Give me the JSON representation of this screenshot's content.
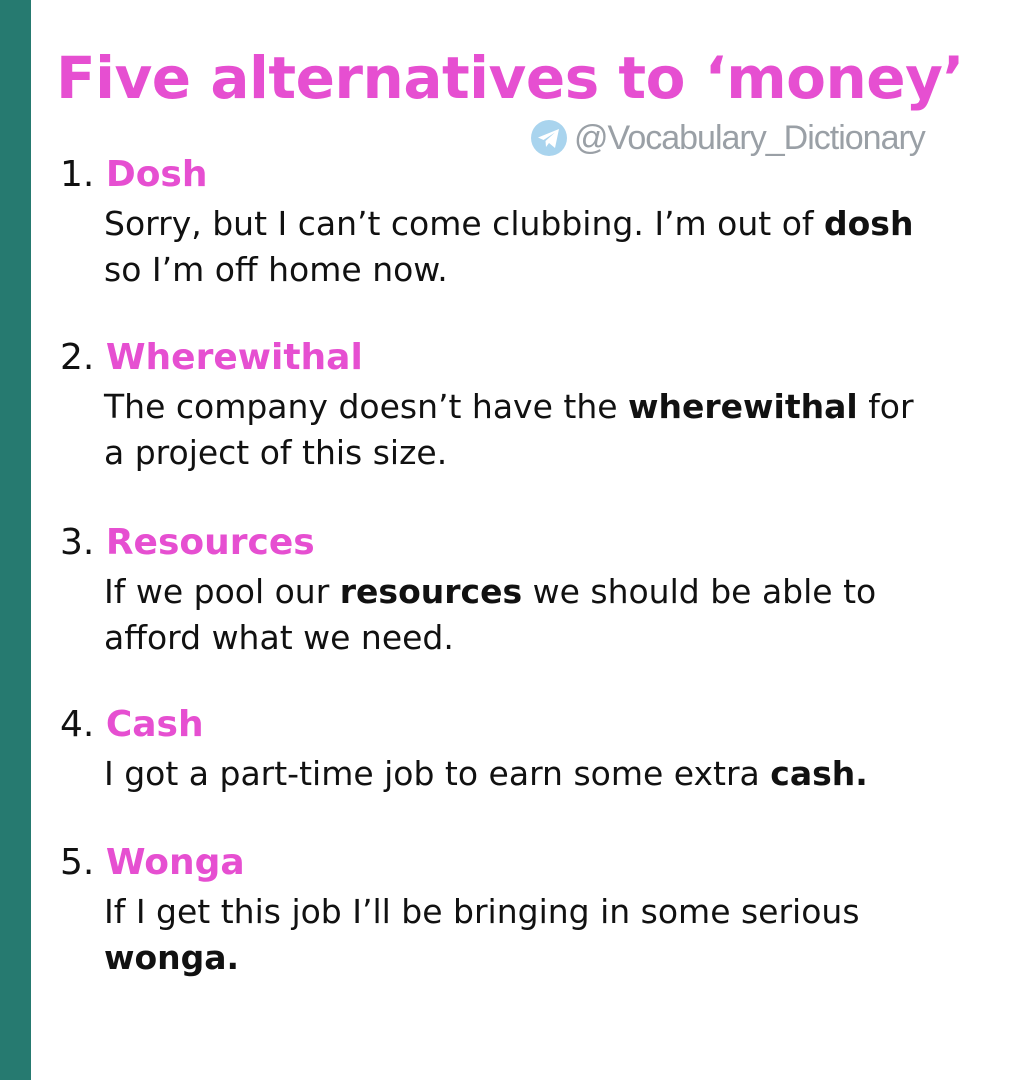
{
  "title": "Five alternatives to ‘money’",
  "watermark": {
    "icon": "telegram-icon",
    "handle": "@Vocabulary_Dictionary"
  },
  "colors": {
    "accent": "#e64fd1",
    "sidebar": "#267a70",
    "watermark": "#9aa0a6",
    "text": "#111111"
  },
  "items": [
    {
      "number": "1.",
      "word": "Dosh",
      "line1_before": "Sorry, but I can’t come clubbing. I’m out of ",
      "line1_bold": "dosh",
      "line1_after": "",
      "line2_before": "so I’m off home now.",
      "line2_bold": "",
      "line2_after": ""
    },
    {
      "number": "2.",
      "word": "Wherewithal",
      "line1_before": "The company doesn’t have the ",
      "line1_bold": "wherewithal",
      "line1_after": " for",
      "line2_before": "a project of this size.",
      "line2_bold": "",
      "line2_after": ""
    },
    {
      "number": "3.",
      "word": "Resources",
      "line1_before": "If we pool our ",
      "line1_bold": "resources",
      "line1_after": " we should be able to",
      "line2_before": "afford what we need.",
      "line2_bold": "",
      "line2_after": ""
    },
    {
      "number": "4.",
      "word": "Cash",
      "line1_before": "I got a part-time job to earn some extra ",
      "line1_bold": "cash.",
      "line1_after": "",
      "line2_before": "",
      "line2_bold": "",
      "line2_after": ""
    },
    {
      "number": "5.",
      "word": "Wonga",
      "line1_before": "If I get this job I’ll be bringing in some serious",
      "line1_bold": "",
      "line1_after": "",
      "line2_before": "",
      "line2_bold": "wonga.",
      "line2_after": ""
    }
  ]
}
